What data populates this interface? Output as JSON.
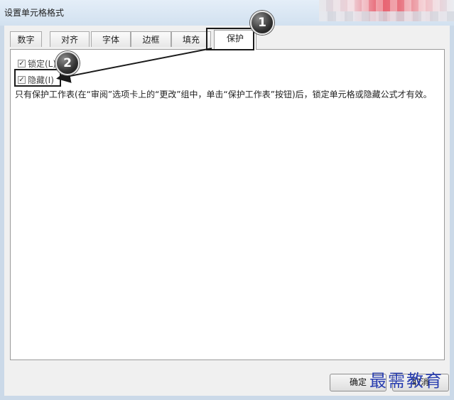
{
  "window": {
    "title": "设置单元格格式"
  },
  "tabs": [
    {
      "label": "数字"
    },
    {
      "label": "对齐"
    },
    {
      "label": "字体"
    },
    {
      "label": "边框"
    },
    {
      "label": "填充"
    },
    {
      "label": "保护",
      "active": true
    }
  ],
  "protection": {
    "locked": {
      "label": "锁定(L)",
      "checked": true
    },
    "hidden": {
      "label": "隐藏(I)",
      "checked": true
    },
    "description": "只有保护工作表(在“审阅”选项卡上的“更改”组中，单击“保护工作表”按钮)后，锁定单元格或隐藏公式才有效。"
  },
  "buttons": {
    "ok": "确定",
    "cancel": "取消"
  },
  "annotations": {
    "step1": "1",
    "step2": "2"
  },
  "watermark": "最需教育",
  "colors": {
    "annotation": "#1a1a1a",
    "watermark": "#2a3fb0"
  }
}
